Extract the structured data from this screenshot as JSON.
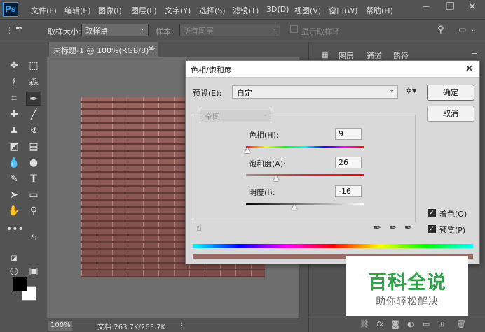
{
  "app": {
    "logo": "Ps"
  },
  "menu": [
    "文件(F)",
    "编辑(E)",
    "图像(I)",
    "图层(L)",
    "文字(Y)",
    "选择(S)",
    "滤镜(T)",
    "3D(D)",
    "视图(V)",
    "窗口(W)",
    "帮助(H)"
  ],
  "options_bar": {
    "sample_size_label": "取样大小:",
    "sample_size_value": "取样点",
    "sample_label": "样本:",
    "sample_value": "所有图层",
    "show_ring_label": "显示取样环"
  },
  "document": {
    "tab_title": "未标题-1 @ 100%(RGB/8) *",
    "zoom": "100%",
    "doc_info": "文档:263.7K/263.7K"
  },
  "panels": {
    "tabs": [
      "图层",
      "通道",
      "路径"
    ]
  },
  "dialog": {
    "title": "色相/饱和度",
    "preset_label": "预设(E):",
    "preset_value": "自定",
    "ok_label": "确定",
    "cancel_label": "取消",
    "channel_value": "全图",
    "hue_label": "色相(H):",
    "hue_value": "9",
    "saturation_label": "饱和度(A):",
    "saturation_value": "26",
    "lightness_label": "明度(I):",
    "lightness_value": "-16",
    "colorize_label": "着色(O)",
    "colorize_checked": true,
    "preview_label": "预览(P)",
    "preview_checked": true
  },
  "colors": {
    "foreground": "#000000",
    "background": "#ffffff",
    "brick": "#8c5955",
    "watermark_green": "#2fa24a"
  },
  "watermark": {
    "title": "百科全说",
    "subtitle": "助你轻松解决"
  }
}
